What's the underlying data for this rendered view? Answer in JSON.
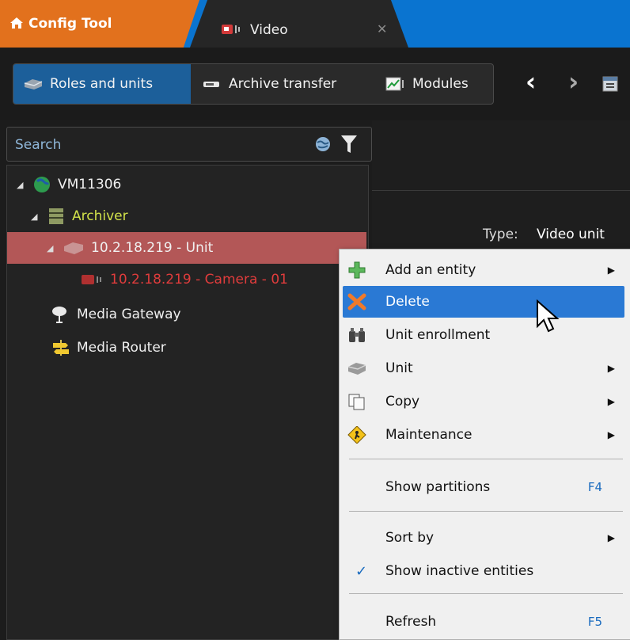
{
  "tabs": {
    "home_label": "Config Tool",
    "video_label": "Video",
    "close_glyph": "✕"
  },
  "toolbar": {
    "buttons": [
      {
        "label": "Roles and units",
        "icon": "server-icon",
        "active": true
      },
      {
        "label": "Archive transfer",
        "icon": "transfer-icon",
        "active": false
      },
      {
        "label": "Modules",
        "icon": "chart-icon",
        "active": false
      }
    ],
    "back_glyph": "‹",
    "forward_glyph": "›"
  },
  "search": {
    "placeholder": "Search"
  },
  "tree": {
    "root": "VM11306",
    "archiver": "Archiver",
    "unit": "10.2.18.219 - Unit",
    "camera": "10.2.18.219 - Camera - 01",
    "media_gateway": "Media Gateway",
    "media_router": "Media Router"
  },
  "details": {
    "type_label": "Type:",
    "type_value": "Video unit"
  },
  "context_menu": {
    "items": [
      {
        "label": "Add an entity",
        "icon": "add-icon",
        "submenu": true
      },
      {
        "label": "Delete",
        "icon": "delete-icon",
        "highlighted": true
      },
      {
        "label": "Unit enrollment",
        "icon": "binoculars-icon"
      },
      {
        "label": "Unit",
        "icon": "unit-icon",
        "submenu": true
      },
      {
        "label": "Copy",
        "icon": "copy-icon",
        "submenu": true
      },
      {
        "label": "Maintenance",
        "icon": "maintenance-icon",
        "submenu": true
      },
      {
        "label": "Show partitions",
        "shortcut": "F4"
      },
      {
        "label": "Sort by",
        "submenu": true
      },
      {
        "label": "Show inactive entities",
        "checked": true
      },
      {
        "label": "Refresh",
        "shortcut": "F5"
      }
    ]
  },
  "colors": {
    "accent_blue": "#0a74d0",
    "home_tab_orange": "#e2711d",
    "selection_red": "#b35757",
    "menu_highlight": "#2a79d4"
  }
}
